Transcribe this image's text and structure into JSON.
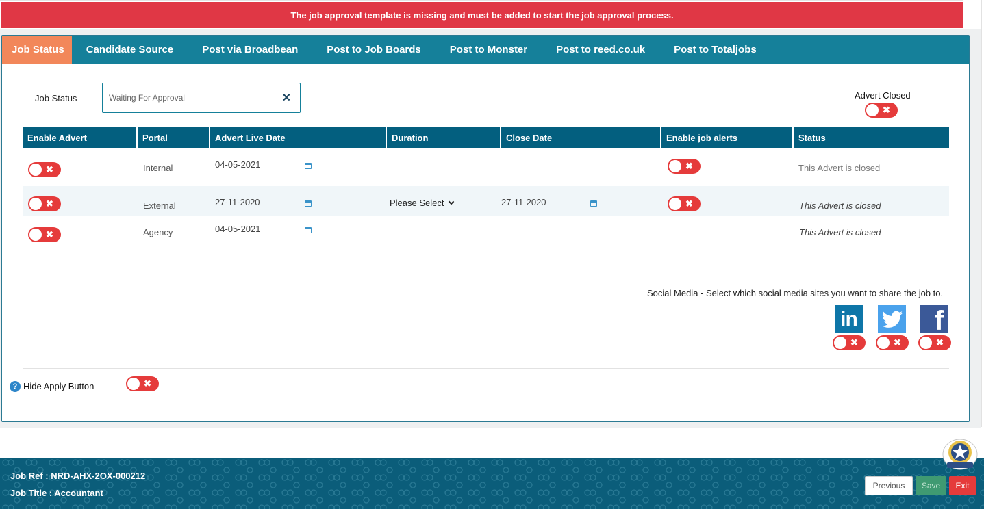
{
  "alert": {
    "message": "The job approval template is missing and must be added to start the job approval process."
  },
  "tabs": [
    {
      "label": "Job Status",
      "active": true
    },
    {
      "label": "Candidate Source"
    },
    {
      "label": "Post via Broadbean"
    },
    {
      "label": "Post to Job Boards"
    },
    {
      "label": "Post to Monster"
    },
    {
      "label": "Post to reed.co.uk"
    },
    {
      "label": "Post to Totaljobs"
    }
  ],
  "job_status": {
    "label": "Job Status",
    "value": "Waiting For Approval",
    "clear_icon": "close-icon"
  },
  "advert_closed": {
    "label": "Advert Closed",
    "toggle": "✖"
  },
  "table": {
    "headers": [
      "Enable Advert",
      "Portal",
      "Advert Live Date",
      "Duration",
      "Close Date",
      "Enable job alerts",
      "Status"
    ],
    "rows": [
      {
        "toggle": "✖",
        "portal": "Internal",
        "live_date": "04-05-2021",
        "alerts_toggle": "✖",
        "status": "This Advert is closed"
      },
      {
        "toggle": "✖",
        "portal": "External",
        "live_date": "27-11-2020",
        "duration": "Please Select",
        "close_date": "27-11-2020",
        "alerts_toggle": "✖",
        "status": "This Advert is closed"
      },
      {
        "toggle": "✖",
        "portal": "Agency",
        "live_date": "04-05-2021",
        "status": "This Advert is closed"
      }
    ]
  },
  "social": {
    "label": "Social Media - Select which social media sites you want to share the job to.",
    "linkedin_text": "in",
    "linkedin_toggle": "✖",
    "twitter_toggle": "✖",
    "facebook_text": "f",
    "facebook_toggle": "✖"
  },
  "hide_apply": {
    "help": "?",
    "label": "Hide Apply Button",
    "toggle": "✖"
  },
  "footer": {
    "job_ref": "Job Ref : NRD-AHX-2OX-000212",
    "job_title": "Job Title : Accountant",
    "previous": "Previous",
    "save": "Save",
    "exit": "Exit"
  },
  "colors": {
    "alert": "#e03745",
    "tab_bar": "#15809a",
    "tab_active": "#f2875a",
    "table_header": "#035f7f",
    "toggle_off": "#e53b3b",
    "footer": "#0b5d7a"
  }
}
